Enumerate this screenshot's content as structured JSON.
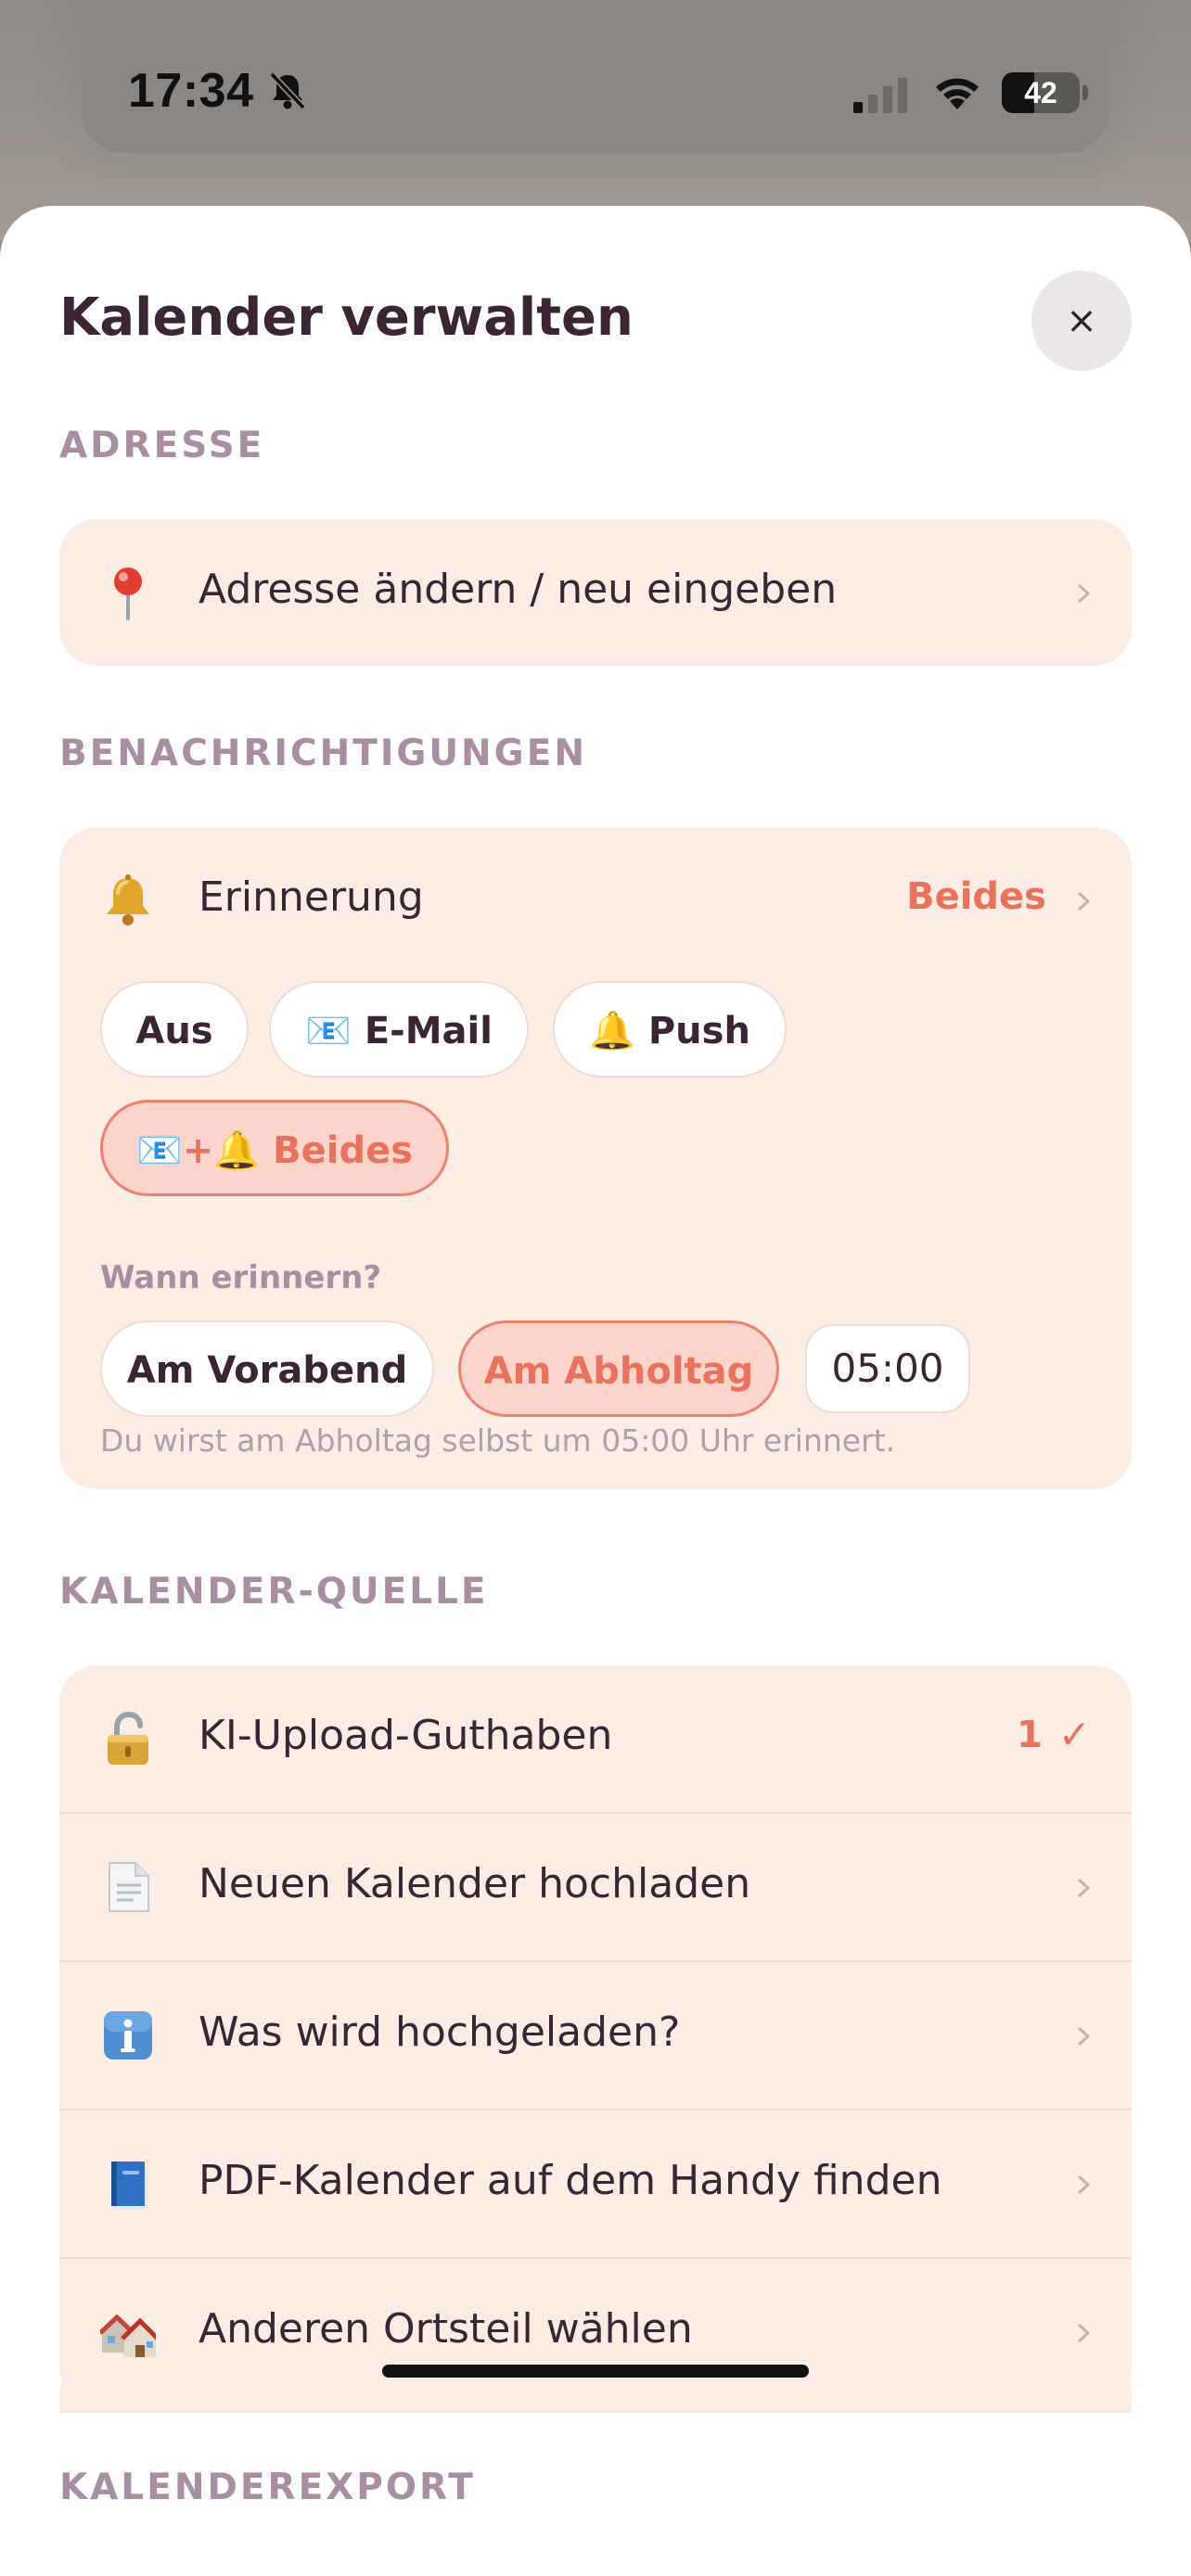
{
  "status_bar": {
    "time": "17:34",
    "battery": "42",
    "battery_level": 0.42
  },
  "sheet": {
    "title": "Kalender verwalten",
    "close_label": "×"
  },
  "address": {
    "section_label": "ADRESSE",
    "change_label": "Adresse ändern / neu eingeben",
    "icon": "pin-icon"
  },
  "notifications": {
    "section_label": "BENACHRICHTIGUNGEN",
    "reminder_label": "Erinnerung",
    "reminder_value": "Beides",
    "options": {
      "off": "Aus",
      "email": "E-Mail",
      "push": "Push",
      "both": "Beides"
    },
    "email_glyph": "📧",
    "push_glyph": "🔔",
    "both_glyph": "📧+🔔",
    "selected_option": "both",
    "when_label": "Wann erinnern?",
    "when_options": {
      "evening": "Am Vorabend",
      "day": "Am Abholtag"
    },
    "selected_when": "day",
    "time": "05:00",
    "hint": "Du wirst am Abholtag selbst um 05:00 Uhr erinnert."
  },
  "calendar_source": {
    "section_label": "KALENDER-QUELLE",
    "credits_label": "KI-Upload-Guthaben",
    "credits_value": "1",
    "credits_check": "✓",
    "upload_label": "Neuen Kalender hochladen",
    "info_label": "Was wird hochgeladen?",
    "find_pdf_label": "PDF-Kalender auf dem Handy finden",
    "district_label": "Anderen Ortsteil wählen"
  },
  "calendar_export": {
    "section_label": "KALENDEREXPORT"
  },
  "colors": {
    "accent": "#e8725d",
    "card_bg": "#fbede3",
    "section_label": "#a98ea3",
    "text": "#3b2535"
  }
}
